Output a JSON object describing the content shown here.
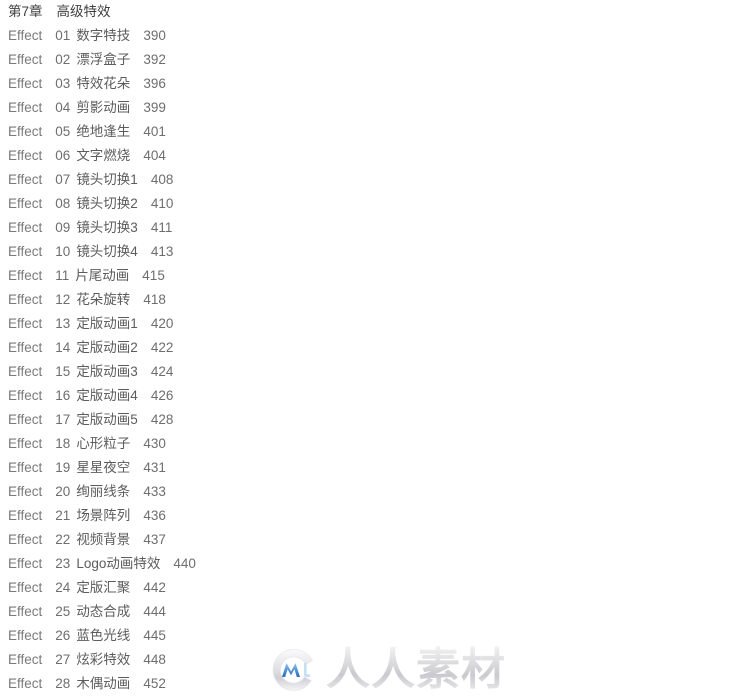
{
  "page": {
    "background_color": "#ffffff",
    "text_color": "#6e6e6e",
    "heading_color": "#3f3f3f"
  },
  "chapter": {
    "number_label": "第7章",
    "title": "高级特效"
  },
  "toc": {
    "entry_label": "Effect",
    "entries": [
      {
        "label": "Effect",
        "number": "01",
        "title": "数字特技",
        "page": "390"
      },
      {
        "label": "Effect",
        "number": "02",
        "title": "漂浮盒子",
        "page": "392"
      },
      {
        "label": "Effect",
        "number": "03",
        "title": "特效花朵",
        "page": "396"
      },
      {
        "label": "Effect",
        "number": "04",
        "title": "剪影动画",
        "page": "399"
      },
      {
        "label": "Effect",
        "number": "05",
        "title": "绝地逢生",
        "page": "401"
      },
      {
        "label": "Effect",
        "number": "06",
        "title": "文字燃烧",
        "page": "404"
      },
      {
        "label": "Effect",
        "number": "07",
        "title": "镜头切换1",
        "page": "408"
      },
      {
        "label": "Effect",
        "number": "08",
        "title": "镜头切换2",
        "page": "410"
      },
      {
        "label": "Effect",
        "number": "09",
        "title": "镜头切换3",
        "page": "411"
      },
      {
        "label": "Effect",
        "number": "10",
        "title": "镜头切换4",
        "page": "413"
      },
      {
        "label": "Effect",
        "number": "11",
        "title": "片尾动画",
        "page": "415"
      },
      {
        "label": "Effect",
        "number": "12",
        "title": "花朵旋转",
        "page": "418"
      },
      {
        "label": "Effect",
        "number": "13",
        "title": "定版动画1",
        "page": "420"
      },
      {
        "label": "Effect",
        "number": "14",
        "title": "定版动画2",
        "page": "422"
      },
      {
        "label": "Effect",
        "number": "15",
        "title": "定版动画3",
        "page": "424"
      },
      {
        "label": "Effect",
        "number": "16",
        "title": "定版动画4",
        "page": "426"
      },
      {
        "label": "Effect",
        "number": "17",
        "title": "定版动画5",
        "page": "428"
      },
      {
        "label": "Effect",
        "number": "18",
        "title": "心形粒子",
        "page": "430"
      },
      {
        "label": "Effect",
        "number": "19",
        "title": "星星夜空",
        "page": "431"
      },
      {
        "label": "Effect",
        "number": "20",
        "title": "绚丽线条",
        "page": "433"
      },
      {
        "label": "Effect",
        "number": "21",
        "title": "场景阵列",
        "page": "436"
      },
      {
        "label": "Effect",
        "number": "22",
        "title": "视频背景",
        "page": "437"
      },
      {
        "label": "Effect",
        "number": "23",
        "title": "Logo动画特效",
        "page": "440"
      },
      {
        "label": "Effect",
        "number": "24",
        "title": "定版汇聚",
        "page": "442"
      },
      {
        "label": "Effect",
        "number": "25",
        "title": "动态合成",
        "page": "444"
      },
      {
        "label": "Effect",
        "number": "26",
        "title": "蓝色光线",
        "page": "445"
      },
      {
        "label": "Effect",
        "number": "27",
        "title": "炫彩特效",
        "page": "448"
      },
      {
        "label": "Effect",
        "number": "28",
        "title": "木偶动画",
        "page": "452"
      }
    ]
  },
  "watermark": {
    "logo_icon": "circle-m-logo-icon",
    "text": "人人素材",
    "logo_accent_color": "#4f90d8",
    "text_color": "#d5d5d8"
  }
}
